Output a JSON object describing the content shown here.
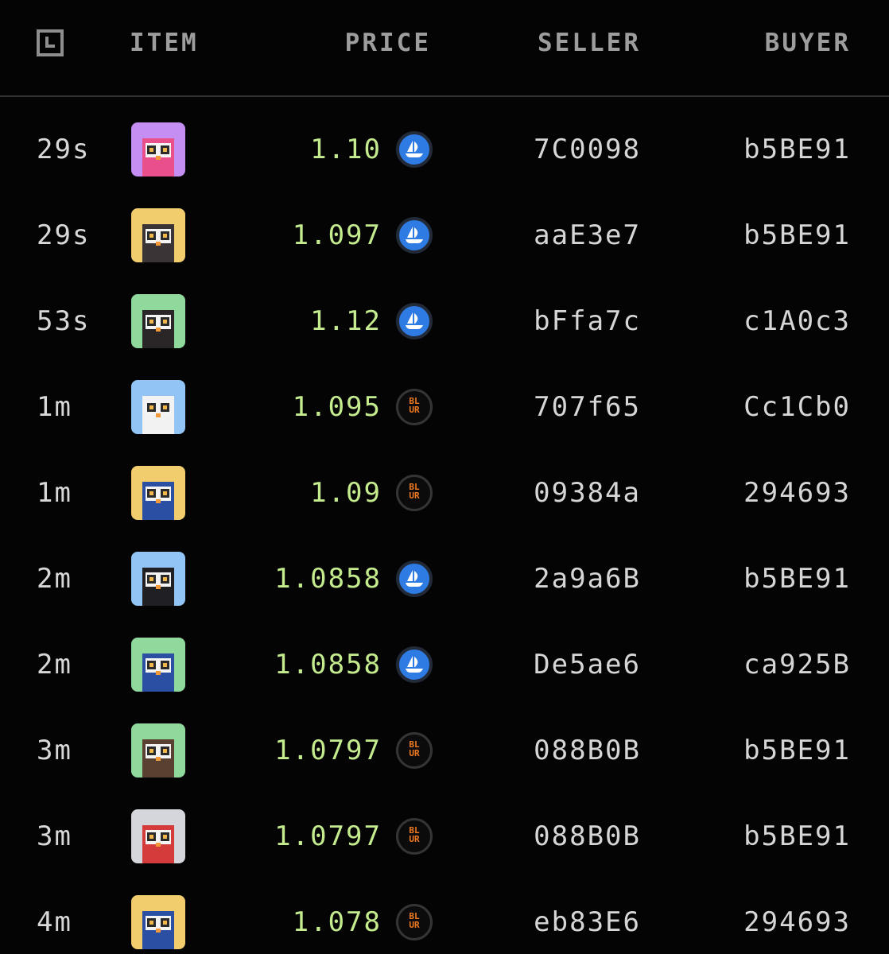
{
  "header": {
    "time_icon": "clock-square-icon",
    "item_label": "ITEM",
    "price_label": "PRICE",
    "seller_label": "SELLER",
    "buyer_label": "BUYER"
  },
  "colors": {
    "background": "#050404",
    "price_green": "#c4ec8e",
    "opensea_blue": "#2e7be4",
    "blur_orange": "#f07a22"
  },
  "sales": [
    {
      "time": "29s",
      "avatar_bg": "#c48ef2",
      "price": "1.10",
      "marketplace": "opensea-icon",
      "seller": "7C0098",
      "buyer": "b5BE91"
    },
    {
      "time": "29s",
      "avatar_bg": "#f2cd6e",
      "price": "1.097",
      "marketplace": "opensea-icon",
      "seller": "aaE3e7",
      "buyer": "b5BE91"
    },
    {
      "time": "53s",
      "avatar_bg": "#8ed99b",
      "price": "1.12",
      "marketplace": "opensea-icon",
      "seller": "bFfa7c",
      "buyer": "c1A0c3"
    },
    {
      "time": "1m",
      "avatar_bg": "#92c4f5",
      "price": "1.095",
      "marketplace": "blur-icon",
      "seller": "707f65",
      "buyer": "Cc1Cb0"
    },
    {
      "time": "1m",
      "avatar_bg": "#f2cd6e",
      "price": "1.09",
      "marketplace": "blur-icon",
      "seller": "09384a",
      "buyer": "294693"
    },
    {
      "time": "2m",
      "avatar_bg": "#92c4f5",
      "price": "1.0858",
      "marketplace": "opensea-icon",
      "seller": "2a9a6B",
      "buyer": "b5BE91"
    },
    {
      "time": "2m",
      "avatar_bg": "#8ed99b",
      "price": "1.0858",
      "marketplace": "opensea-icon",
      "seller": "De5ae6",
      "buyer": "ca925B"
    },
    {
      "time": "3m",
      "avatar_bg": "#8ed99b",
      "price": "1.0797",
      "marketplace": "blur-icon",
      "seller": "088B0B",
      "buyer": "b5BE91"
    },
    {
      "time": "3m",
      "avatar_bg": "#d4d6dc",
      "price": "1.0797",
      "marketplace": "blur-icon",
      "seller": "088B0B",
      "buyer": "b5BE91"
    },
    {
      "time": "4m",
      "avatar_bg": "#f2cd6e",
      "price": "1.078",
      "marketplace": "blur-icon",
      "seller": "eb83E6",
      "buyer": "294693"
    }
  ],
  "blur_badge": {
    "line1": "BL",
    "line2": "UR"
  }
}
